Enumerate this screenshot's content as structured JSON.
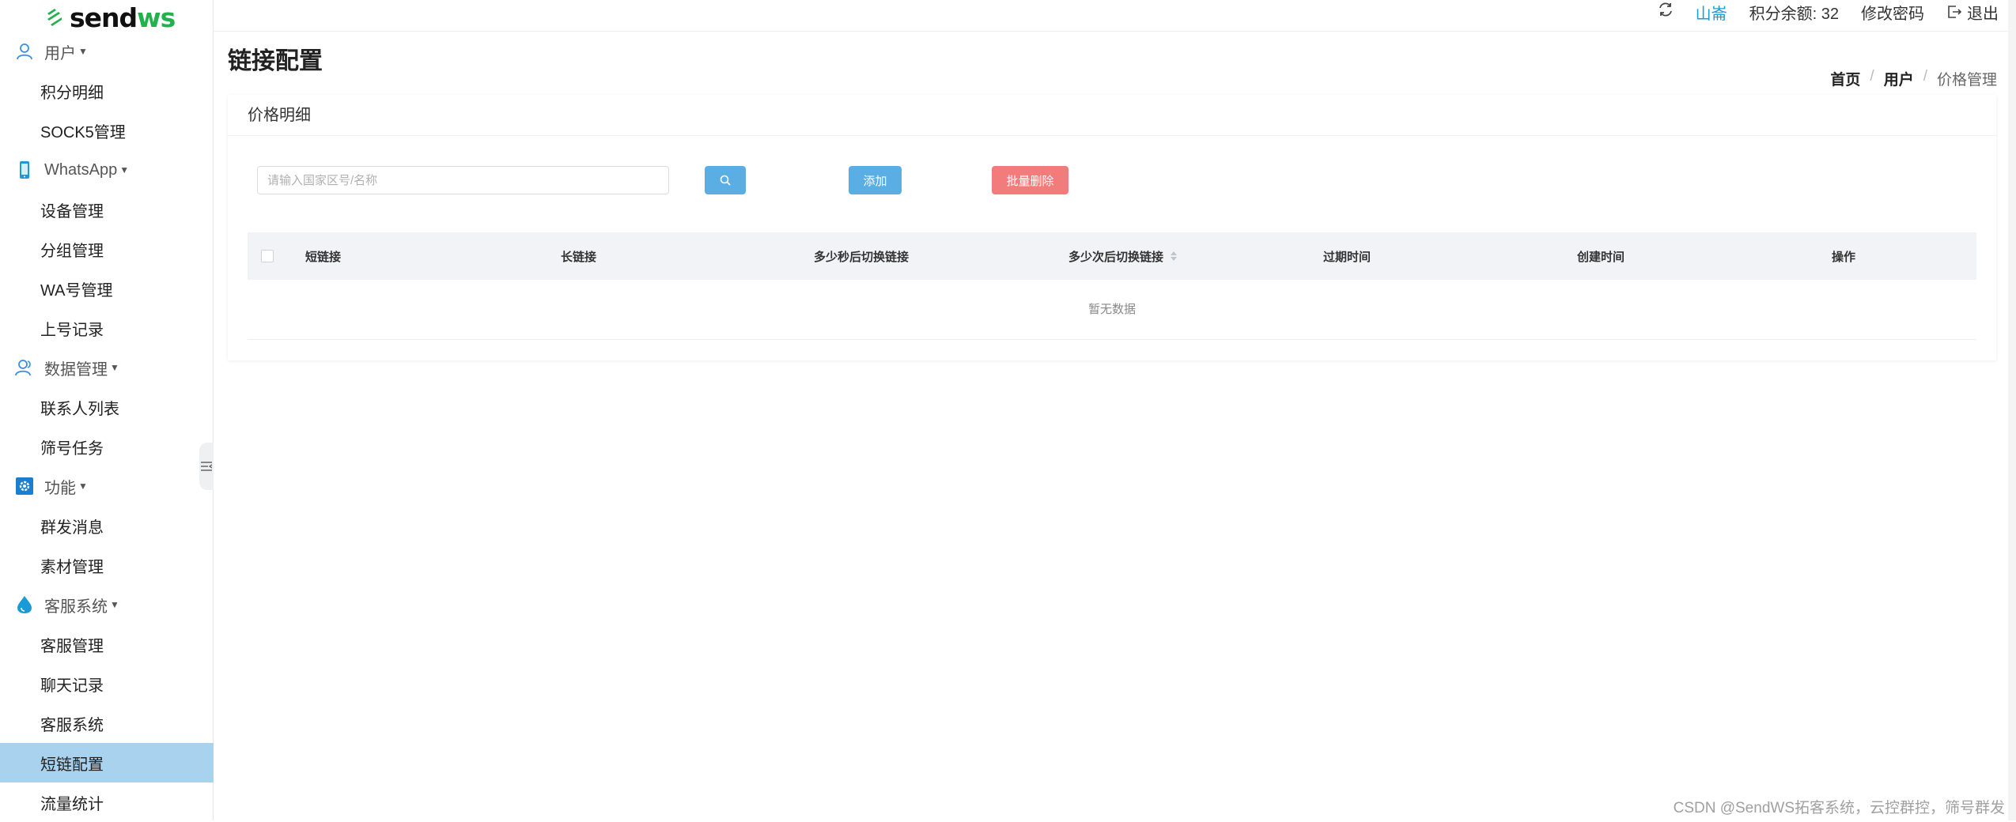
{
  "logo": {
    "text_main": "send",
    "text_accent": "ws",
    "accent_color": "#22b14c"
  },
  "topbar": {
    "user": "山崙",
    "balance": "积分余额: 32",
    "change_password": "修改密码",
    "logout": "退出"
  },
  "sidebar": {
    "groups": [
      {
        "label": "用户",
        "icon": "user-icon",
        "items": [
          "积分明细",
          "SOCK5管理"
        ]
      },
      {
        "label": "WhatsApp",
        "icon": "phone-icon",
        "items": [
          "设备管理",
          "分组管理",
          "WA号管理",
          "上号记录"
        ]
      },
      {
        "label": "数据管理",
        "icon": "users-icon",
        "items": [
          "联系人列表",
          "筛号任务"
        ]
      },
      {
        "label": "功能",
        "icon": "gear-icon",
        "items": [
          "群发消息",
          "素材管理"
        ]
      },
      {
        "label": "客服系统",
        "icon": "drop-icon",
        "items": [
          "客服管理",
          "聊天记录",
          "客服系统",
          "短链配置",
          "流量统计"
        ]
      }
    ],
    "active_item": "短链配置"
  },
  "page": {
    "title": "链接配置",
    "breadcrumb": [
      "首页",
      "用户",
      "价格管理"
    ]
  },
  "card": {
    "title": "价格明细",
    "search_placeholder": "请输入国家区号/名称",
    "add_label": "添加",
    "batch_delete_label": "批量删除"
  },
  "table": {
    "columns": [
      "短链接",
      "长链接",
      "多少秒后切换链接",
      "多少次后切换链接",
      "过期时间",
      "创建时间",
      "操作"
    ],
    "empty_text": "暂无数据"
  },
  "colors": {
    "primary": "#5aaee4",
    "danger": "#f27b7b",
    "active_bg": "#a9d2ee",
    "link": "#1a9bd7"
  },
  "watermark": "CSDN @SendWS拓客系统，云控群控，筛号群发"
}
